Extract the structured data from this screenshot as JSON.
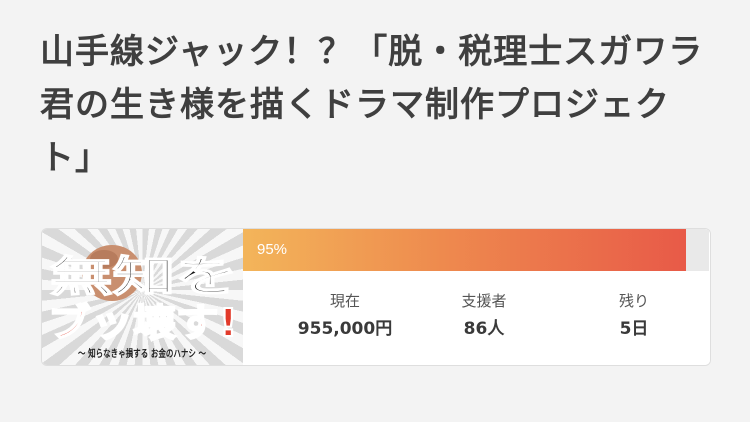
{
  "project": {
    "title": "山手線ジャック！？「脱・税理士スガワラ君の生き様を描くドラマ制作プロジェクト」"
  },
  "thumbnail": {
    "line1": "無知を",
    "line2": "ブッ壊す!",
    "tagline": "〜 知らなきゃ損する お金のハナシ 〜"
  },
  "progress": {
    "percent_label": "95%",
    "fraction": 0.95
  },
  "stats": [
    {
      "label": "現在",
      "value": "955,000円"
    },
    {
      "label": "支援者",
      "value": "86人"
    },
    {
      "label": "残り",
      "value": "5日"
    }
  ],
  "colors": {
    "progress_start": "#f3b55a",
    "progress_end": "#e85a48",
    "thumb_accent": "#e23a2a"
  }
}
